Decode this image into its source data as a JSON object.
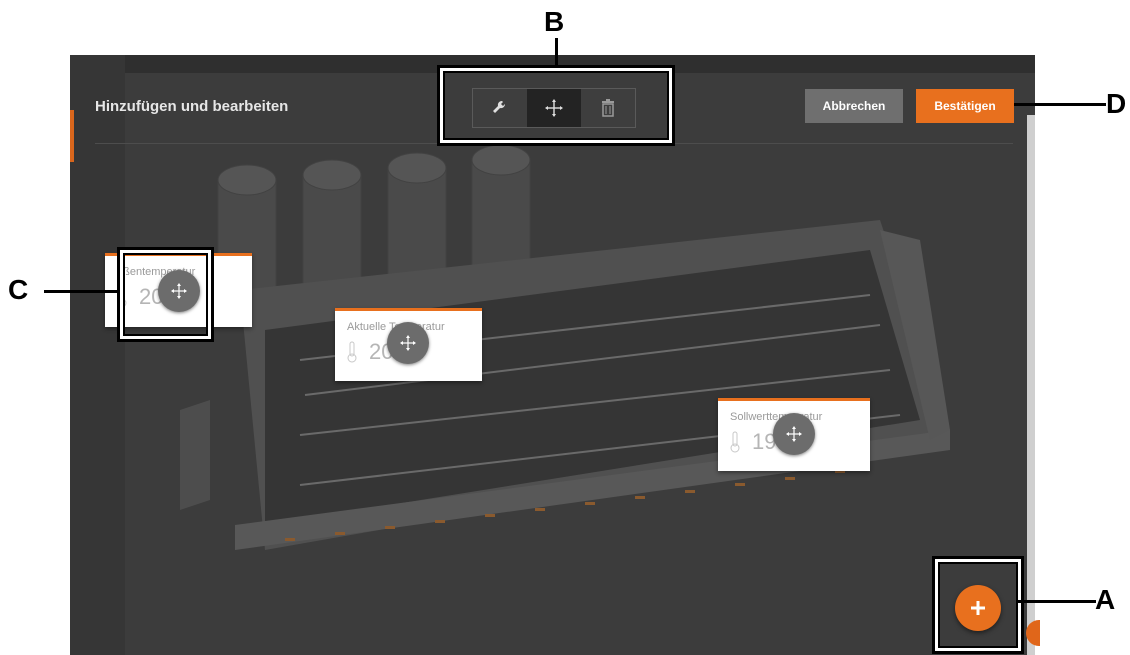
{
  "dialog": {
    "title": "Hinzufügen und bearbeiten"
  },
  "toolbar": {
    "tools": [
      {
        "name": "edit",
        "icon": "wrench-icon"
      },
      {
        "name": "move",
        "icon": "move-icon",
        "active": true
      },
      {
        "name": "delete",
        "icon": "trash-icon"
      }
    ]
  },
  "actions": {
    "cancel_label": "Abbrechen",
    "confirm_label": "Bestätigen"
  },
  "widgets": [
    {
      "label": "ußentemperatur",
      "value": "20",
      "icon": "thermometer-icon"
    },
    {
      "label": "Aktuelle Temperatur",
      "value": "20",
      "icon": "thermometer-icon"
    },
    {
      "label": "Sollwerttemperatur",
      "value": "19",
      "icon": "thermometer-icon"
    }
  ],
  "fab": {
    "label": "+"
  },
  "annotations": {
    "a": "A",
    "b": "B",
    "c": "C",
    "d": "D"
  },
  "colors": {
    "accent": "#e8701e",
    "background": "#3c3c3c",
    "cancel": "#6f6f6f"
  }
}
